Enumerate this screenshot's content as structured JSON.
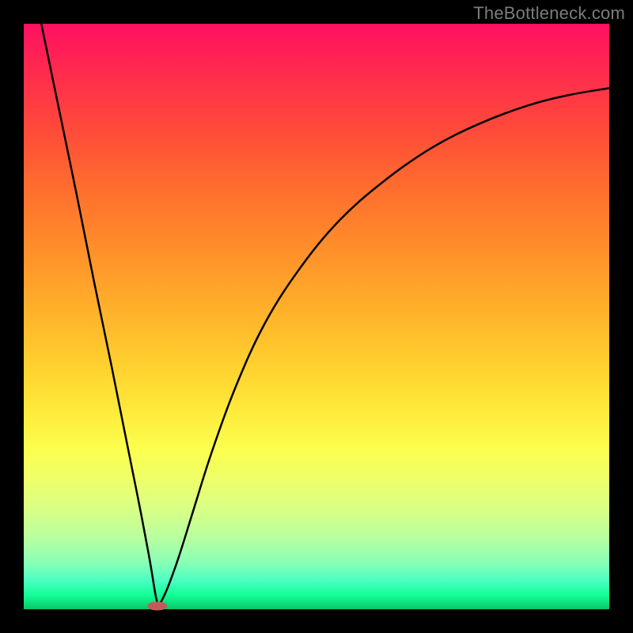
{
  "watermark": "TheBottleneck.com",
  "chart_data": {
    "type": "line",
    "title": "",
    "xlabel": "",
    "ylabel": "",
    "xlim": [
      0,
      1
    ],
    "ylim": [
      0,
      1
    ],
    "axes_visible": false,
    "grid": false,
    "background": "red-yellow-green vertical gradient",
    "notes": "Two black curves forming a V / funnel. Left branch: steep nearly-linear descent from top-left toward a cusp near x≈0.23, y≈0. Right branch: concave curve rising from the cusp toward upper-right, flattening out near y≈0.88 at x=1. Small reddish oval marker at the cusp.",
    "series": [
      {
        "name": "left-branch",
        "x": [
          0.03,
          0.06,
          0.09,
          0.12,
          0.15,
          0.18,
          0.2,
          0.215,
          0.225,
          0.23
        ],
        "y": [
          1.0,
          0.855,
          0.71,
          0.56,
          0.415,
          0.265,
          0.165,
          0.085,
          0.025,
          0.004
        ]
      },
      {
        "name": "right-branch",
        "x": [
          0.23,
          0.245,
          0.265,
          0.29,
          0.32,
          0.36,
          0.41,
          0.47,
          0.54,
          0.62,
          0.7,
          0.78,
          0.86,
          0.93,
          1.0
        ],
        "y": [
          0.004,
          0.035,
          0.09,
          0.17,
          0.265,
          0.375,
          0.485,
          0.58,
          0.665,
          0.735,
          0.79,
          0.83,
          0.86,
          0.878,
          0.89
        ]
      }
    ],
    "marker": {
      "x": 0.228,
      "y": 0.0055,
      "rx": 0.017,
      "ry": 0.0075,
      "fill": "#c25a5a"
    }
  }
}
